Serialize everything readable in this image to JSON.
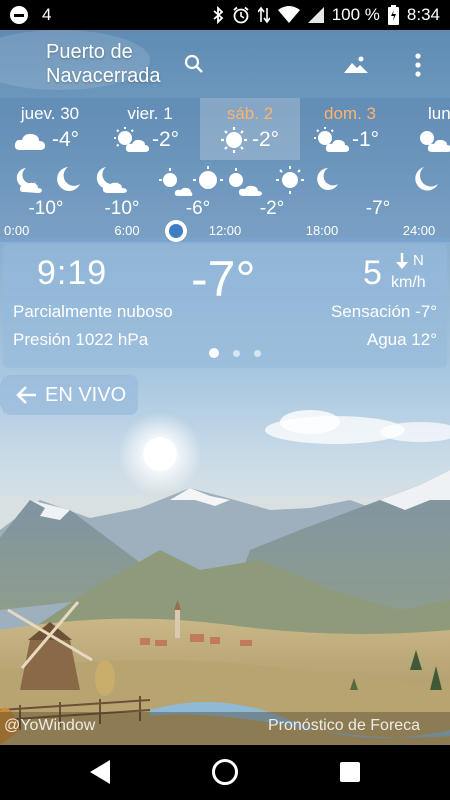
{
  "status": {
    "notif_number": "4",
    "battery": "100 %",
    "time": "8:34"
  },
  "location": "Puerto de\nNavacerrada",
  "days": [
    {
      "label": "juev. 30",
      "temp": "-4°",
      "icon": "partly-cloudy-icon",
      "selected": false,
      "weekend": false
    },
    {
      "label": "vier. 1",
      "temp": "-2°",
      "icon": "sun-cloud-icon",
      "selected": false,
      "weekend": false
    },
    {
      "label": "sáb. 2",
      "temp": "-2°",
      "icon": "sun-icon",
      "selected": true,
      "weekend": true
    },
    {
      "label": "dom. 3",
      "temp": "-1°",
      "icon": "sun-cloud-icon",
      "selected": false,
      "weekend": true
    },
    {
      "label": "lun",
      "temp": "",
      "icon": "sun-cloud-icon",
      "selected": false,
      "weekend": false
    }
  ],
  "hours": {
    "temps": [
      "-10°",
      "-10°",
      "-6°",
      "-2°",
      "-7°"
    ],
    "labels": [
      "0:00",
      "6:00",
      "12:00",
      "18:00",
      "24:00"
    ],
    "slider_position": 0.39
  },
  "current": {
    "time": "9:19",
    "temp": "-7°",
    "wind_speed": "5",
    "wind_dir": "N",
    "wind_unit": "km/h",
    "condition": "Parcialmente nuboso",
    "feels_like": "Sensación -7°",
    "pressure": "Presión 1022 hPa",
    "water": "Agua 12°"
  },
  "live_button": "EN VIVO",
  "credits": {
    "left": "@YoWindow",
    "right": "Pronóstico de Foreca"
  },
  "colors": {
    "accent_weekend": "#ffb36b",
    "slider": "#3f7fc1"
  }
}
